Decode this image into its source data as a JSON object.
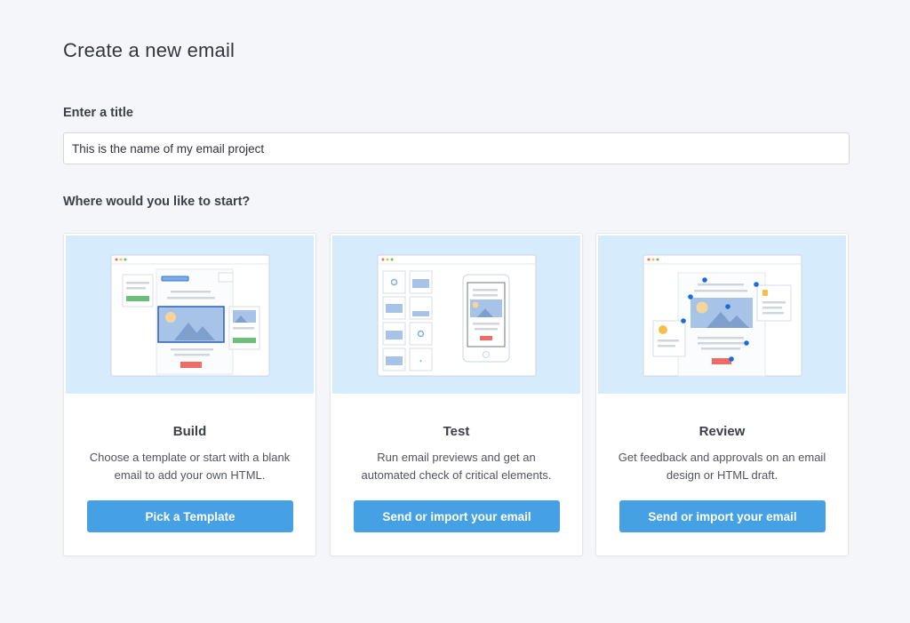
{
  "page": {
    "title": "Create a new email"
  },
  "title_field": {
    "label": "Enter a title",
    "value": "This is the name of my email project"
  },
  "start_section": {
    "label": "Where would you like to start?"
  },
  "cards": [
    {
      "title": "Build",
      "description": "Choose a template or start with a blank email to add your own HTML.",
      "button": "Pick a Template"
    },
    {
      "title": "Test",
      "description": "Run email previews and get an automated check of critical elements.",
      "button": "Send or import your email"
    },
    {
      "title": "Review",
      "description": "Get feedback and approvals on an email design or HTML draft.",
      "button": "Send or import your email"
    }
  ],
  "colors": {
    "accent": "#45a1e3",
    "illustration_bg": "#d6ebfb",
    "page_bg": "#f4f6f9"
  }
}
